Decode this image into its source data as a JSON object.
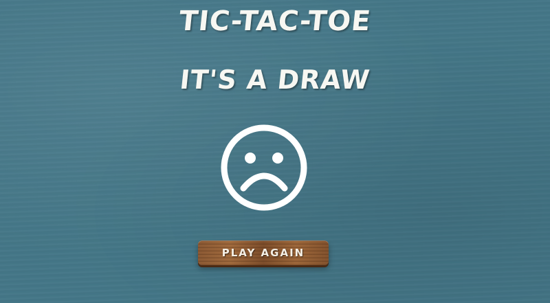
{
  "game": {
    "title": "TIC-TAC-TOE",
    "result_text": "IT'S A DRAW",
    "result_icon": "sad-face-icon",
    "play_again_label": "PLAY AGAIN"
  },
  "colors": {
    "background": "#447687",
    "text": "#f7f7f2",
    "button_wood": "#8c5a34"
  }
}
